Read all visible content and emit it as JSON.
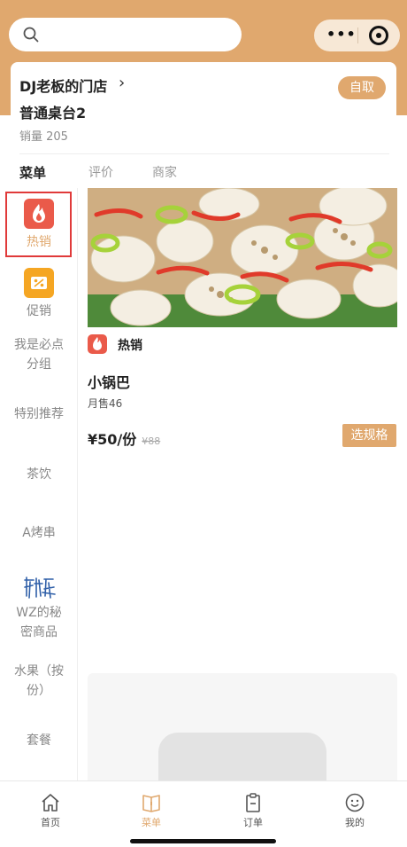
{
  "store": {
    "name": "DJ老板的门店",
    "chevron": "›",
    "pickup_label": "自取",
    "table": "普通桌台2",
    "sales": "销量 205"
  },
  "tabs": [
    {
      "label": "菜单",
      "active": true
    },
    {
      "label": "评价",
      "active": false
    },
    {
      "label": "商家",
      "active": false
    }
  ],
  "sidebar": {
    "items": [
      {
        "label": "热销",
        "icon": "fire-icon",
        "selected": true
      },
      {
        "label": "促销",
        "icon": "discount-icon",
        "selected": false
      },
      {
        "label": "我是必点分组",
        "selected": false
      },
      {
        "label": "特别推荐",
        "selected": false
      },
      {
        "label": "茶饮",
        "selected": false
      },
      {
        "label": "A烤串",
        "selected": false
      },
      {
        "label": "WZ的秘密商品",
        "icon": "calligraphy-logo",
        "selected": false
      },
      {
        "label": "水果（按份）",
        "selected": false
      },
      {
        "label": "套餐",
        "selected": false
      }
    ]
  },
  "section": {
    "tag_label": "热销",
    "tag_icon": "fire-icon"
  },
  "product": {
    "name": "小锅巴",
    "monthly_sales": "月售46",
    "price": "¥50",
    "unit": "/份",
    "original_price": "¥88",
    "spec_button": "选规格",
    "image": "lotus-root-with-peppers-photo"
  },
  "bottom_nav": [
    {
      "label": "首页",
      "icon": "home-icon",
      "active": false
    },
    {
      "label": "菜单",
      "icon": "menu-book-icon",
      "active": true
    },
    {
      "label": "订单",
      "icon": "order-clipboard-icon",
      "active": false
    },
    {
      "label": "我的",
      "icon": "smiley-icon",
      "active": false
    }
  ],
  "colors": {
    "brand": "#e0a86e",
    "highlight_border": "#e03a3a",
    "hot_tag": "#ea5a4a",
    "promo_tag": "#f5a623"
  }
}
